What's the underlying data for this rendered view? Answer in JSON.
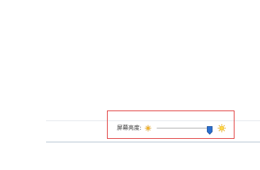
{
  "brightness": {
    "label": "屏幕亮度:",
    "value_fraction": 0.96,
    "low_icon": "sun-dim-icon",
    "high_icon": "sun-bright-icon",
    "thumb_color": "#2a6fd0"
  },
  "highlight_color": "#e03a3a"
}
